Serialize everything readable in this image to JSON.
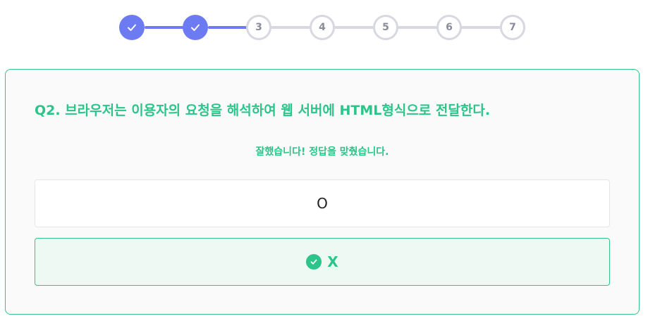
{
  "stepper": {
    "steps": [
      {
        "label": "",
        "state": "done"
      },
      {
        "label": "",
        "state": "done"
      },
      {
        "label": "3",
        "state": "todo"
      },
      {
        "label": "4",
        "state": "todo"
      },
      {
        "label": "5",
        "state": "todo"
      },
      {
        "label": "6",
        "state": "todo"
      },
      {
        "label": "7",
        "state": "todo"
      }
    ],
    "done_color": "#6c7bf2",
    "todo_color": "#d7d8e0"
  },
  "quiz": {
    "question": "Q2. 브라우저는 이용자의 요청을 해석하여 웹 서버에 HTML형식으로 전달한다.",
    "feedback": "잘했습니다! 정답을 맞췄습니다.",
    "options": [
      {
        "label": "O",
        "selected": false
      },
      {
        "label": "X",
        "selected": true,
        "icon": "check-circle-icon"
      }
    ],
    "accent_color": "#2bc48a"
  }
}
